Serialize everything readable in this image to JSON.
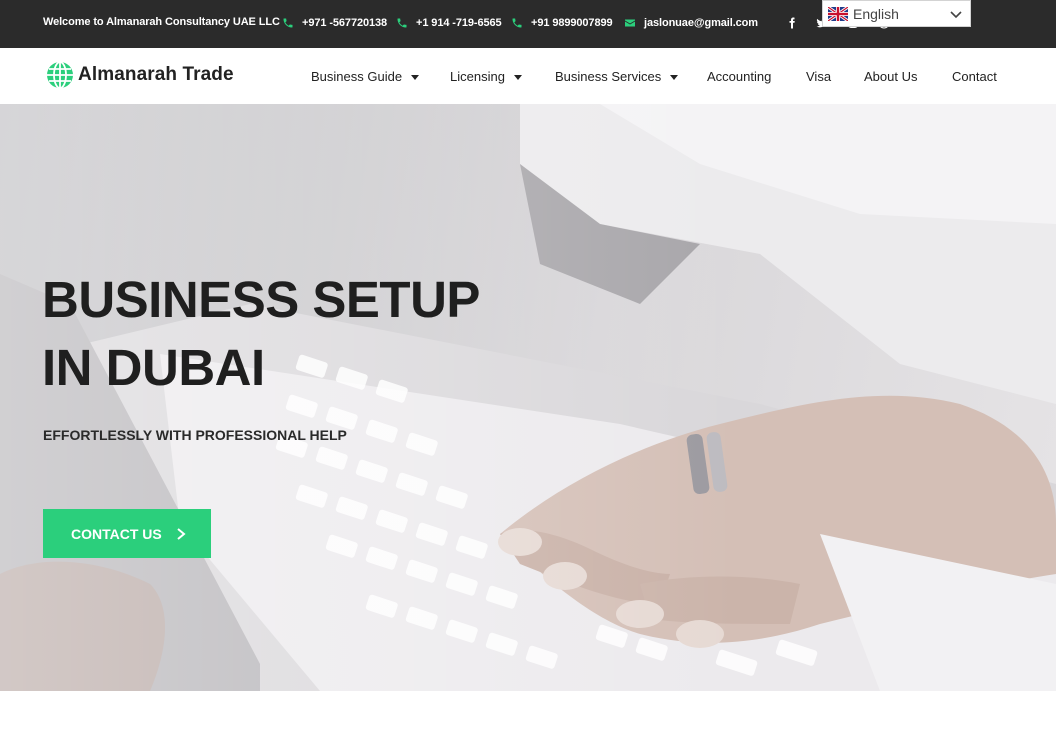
{
  "topbar": {
    "welcome": "Welcome to Almanarah Consultancy UAE LLC",
    "contacts": [
      {
        "icon": "phone-icon",
        "text": "+971 -567720138"
      },
      {
        "icon": "phone-icon",
        "text": "+1 914 -719-6565"
      },
      {
        "icon": "phone-icon",
        "text": "+91 9899007899"
      },
      {
        "icon": "email-icon",
        "text": "jaslonuae@gmail.com"
      }
    ],
    "social": [
      "facebook-icon",
      "twitter-icon",
      "instagram-icon",
      "pinterest-icon"
    ],
    "language": {
      "selected": "English",
      "flag": "en-flag-icon"
    }
  },
  "nav": {
    "logo": "Almanarah Trade",
    "items": [
      {
        "label": "Business Guide",
        "dropdown": true
      },
      {
        "label": "Licensing",
        "dropdown": true
      },
      {
        "label": "Business Services",
        "dropdown": true
      },
      {
        "label": "Accounting",
        "dropdown": false
      },
      {
        "label": "Visa",
        "dropdown": false
      },
      {
        "label": "About Us",
        "dropdown": false
      },
      {
        "label": "Contact",
        "dropdown": false
      }
    ]
  },
  "hero": {
    "title": "BUSINESS SETUP\nIN DUBAI",
    "subtitle": "EFFORTLESSLY WITH PROFESSIONAL HELP",
    "cta_label": "CONTACT US"
  },
  "colors": {
    "accent": "#2bcf7c",
    "topbar_bg": "#2b2b2b",
    "text_dark": "#1f1f1f"
  }
}
